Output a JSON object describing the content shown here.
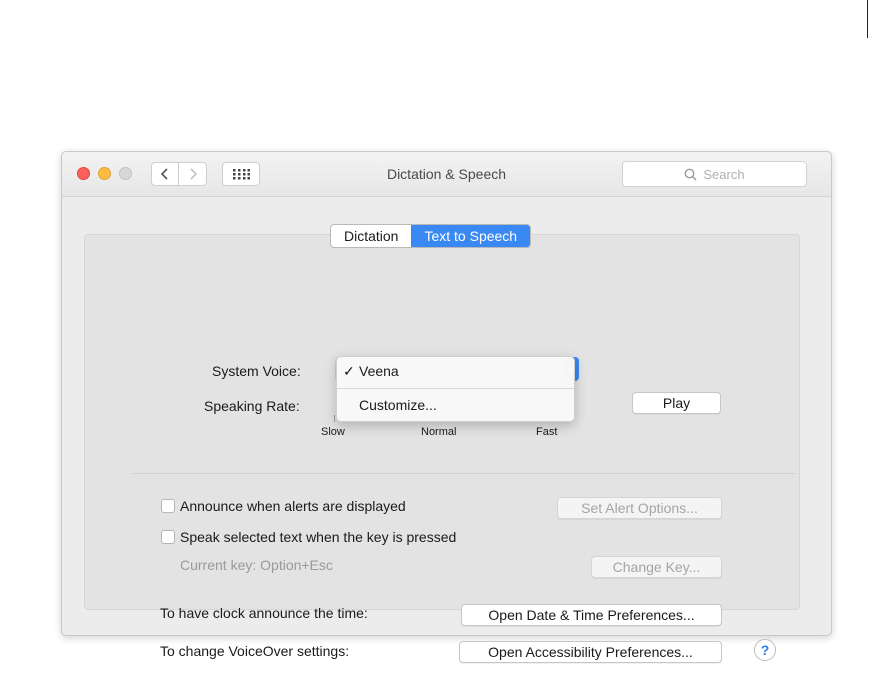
{
  "window": {
    "title": "Dictation & Speech"
  },
  "toolbar": {
    "search_placeholder": "Search"
  },
  "tabs": [
    {
      "label": "Dictation",
      "active": false
    },
    {
      "label": "Text to Speech",
      "active": true
    }
  ],
  "voice": {
    "label": "System Voice:",
    "menu": {
      "selected": "Veena",
      "check_glyph": "✓",
      "customize": "Customize..."
    }
  },
  "rate": {
    "label": "Speaking Rate:",
    "ticks": [
      "Slow",
      "Normal",
      "Fast"
    ],
    "play_label": "Play"
  },
  "announce": {
    "label": "Announce when alerts are displayed",
    "checked": false,
    "options_button": "Set Alert Options..."
  },
  "speak_selected": {
    "label": "Speak selected text when the key is pressed",
    "checked": false,
    "current_key": "Current key: Option+Esc",
    "change_button": "Change Key..."
  },
  "clock": {
    "label": "To have clock announce the time:",
    "button": "Open Date & Time Preferences..."
  },
  "voiceover": {
    "label": "To change VoiceOver settings:",
    "button": "Open Accessibility Preferences..."
  },
  "help": {
    "glyph": "?"
  },
  "colors": {
    "accent": "#3a89f3",
    "close": "#fc605c",
    "minimize": "#fdbc40"
  }
}
